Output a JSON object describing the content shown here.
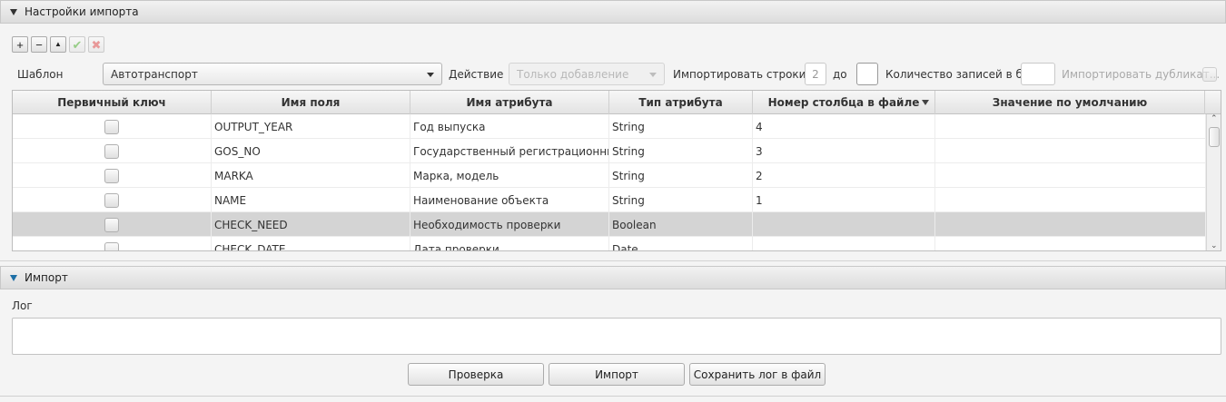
{
  "import_settings": {
    "title": "Настройки импорта",
    "toolbar": {
      "add": "+",
      "remove": "−",
      "move_up": "▲",
      "confirm": "✔",
      "cancel": "✖"
    },
    "template_label": "Шаблон",
    "template_value": "Автотранспорт",
    "action_label": "Действие",
    "action_value": "Только добавление",
    "import_rows_label": "Импортировать строки с",
    "import_rows_from": "2",
    "to_label": "до",
    "import_rows_to": "",
    "batch_count_label": "Количество записей в б...",
    "batch_count_value": "",
    "import_duplicates_label": "Импортировать дубликат..."
  },
  "table": {
    "columns": [
      "Первичный ключ",
      "Имя поля",
      "Имя атрибута",
      "Тип атрибута",
      "Номер столбца в файле",
      "Значение по умолчанию"
    ],
    "rows": [
      {
        "field": "OUTPUT_YEAR",
        "attr": "Год выпуска",
        "type": "String",
        "col": "4",
        "default": ""
      },
      {
        "field": "GOS_NO",
        "attr": "Государственный регистрационный знак",
        "type": "String",
        "col": "3",
        "default": ""
      },
      {
        "field": "MARKA",
        "attr": "Марка, модель",
        "type": "String",
        "col": "2",
        "default": ""
      },
      {
        "field": "NAME",
        "attr": "Наименование объекта",
        "type": "String",
        "col": "1",
        "default": ""
      },
      {
        "field": "CHECK_NEED",
        "attr": "Необходимость проверки",
        "type": "Boolean",
        "col": "",
        "default": ""
      },
      {
        "field": "CHECK_DATE",
        "attr": "Дата проверки",
        "type": "Date",
        "col": "",
        "default": ""
      }
    ]
  },
  "import_pane": {
    "title": "Импорт",
    "log_label": "Лог",
    "log_value": "",
    "check_button": "Проверка",
    "import_button": "Импорт",
    "save_log_button": "Сохранить лог в файл"
  }
}
